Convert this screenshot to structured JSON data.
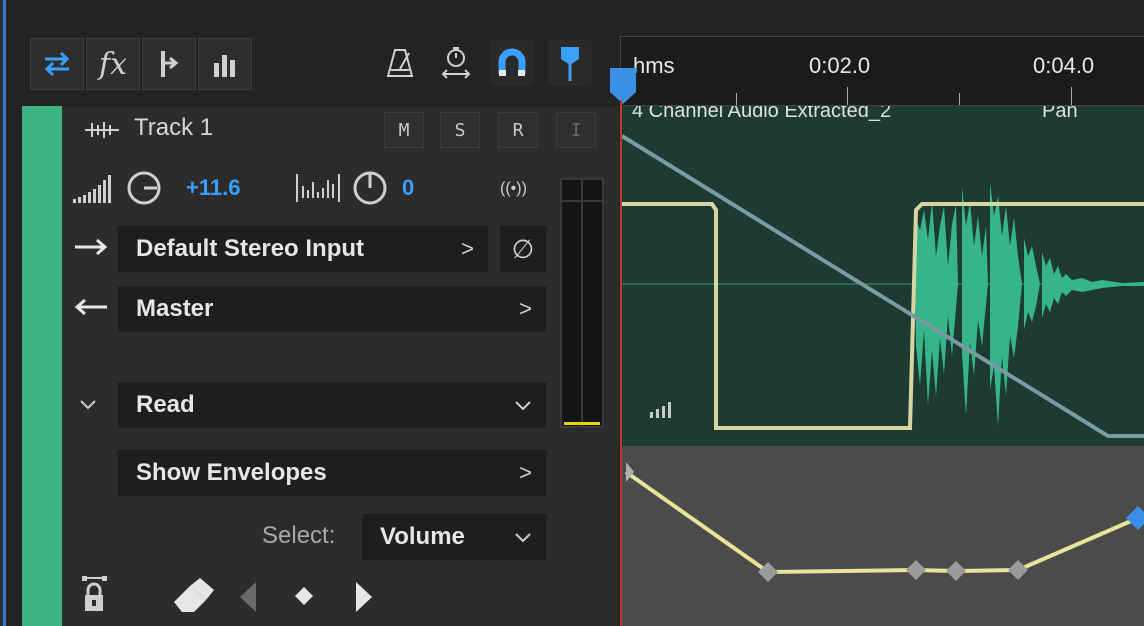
{
  "toolbar": {
    "buttons": [
      {
        "name": "inputs-outputs-icon",
        "active": true
      },
      {
        "name": "effects-icon",
        "label": "fx"
      },
      {
        "name": "sends-icon"
      },
      {
        "name": "eq-icon"
      }
    ]
  },
  "tools": [
    "metronome-icon",
    "time-stretch-icon",
    "snap-magnet-icon",
    "marker-flag-icon"
  ],
  "ruler": {
    "unit": "hms",
    "ticks": [
      "0:02.0",
      "0:04.0"
    ]
  },
  "track": {
    "name": "Track 1",
    "buttons": [
      "M",
      "S",
      "R",
      "I"
    ],
    "volume": "+11.6",
    "pan": "0",
    "input": "Default Stereo Input",
    "output": "Master",
    "automation_mode": "Read",
    "show_envelopes": "Show Envelopes",
    "select_label": "Select:",
    "select_value": "Volume"
  },
  "clip": {
    "title": "4 Channel Audio Extracted_2",
    "right_label": "Pan"
  },
  "colors": {
    "accent": "#3aa0ff",
    "track": "#3db383",
    "clip_bg": "#1d3b33",
    "waveform": "#36b58a",
    "volume_env": "#d8d6a0",
    "pan_env": "#7b9aa3"
  }
}
